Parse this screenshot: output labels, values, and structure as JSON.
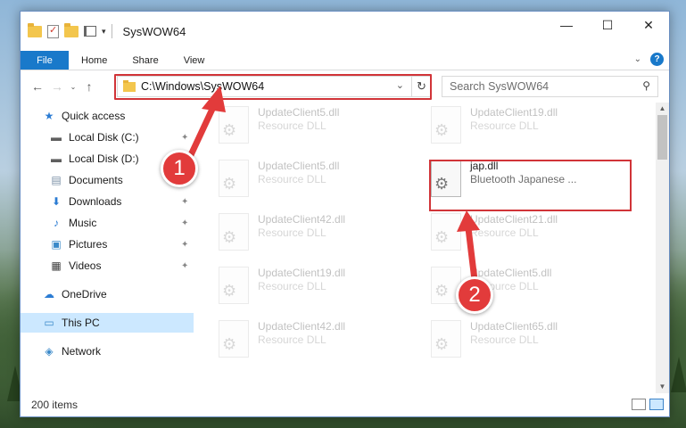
{
  "window": {
    "title": "SysWOW64",
    "minimize_glyph": "—",
    "maximize_glyph": "☐",
    "close_glyph": "✕"
  },
  "ribbon": {
    "tabs": [
      "File",
      "Home",
      "Share",
      "View"
    ],
    "expand_glyph": "⌄",
    "help_glyph": "?"
  },
  "navbar": {
    "back_glyph": "←",
    "forward_glyph": "→",
    "recent_glyph": "⌄",
    "up_glyph": "↑",
    "address": "C:\\Windows\\SysWOW64",
    "dropdown_glyph": "⌄",
    "refresh_glyph": "↻",
    "search_placeholder": "Search SysWOW64",
    "search_glyph": "⚲"
  },
  "sidebar": {
    "items": [
      {
        "label": "Quick access",
        "icon": "star-icon",
        "glyph": "★",
        "color": "#2b7cd3"
      },
      {
        "label": "Local Disk (C:)",
        "icon": "drive-icon",
        "glyph": "▬",
        "color": "#5f5f5f"
      },
      {
        "label": "Local Disk (D:)",
        "icon": "drive-icon",
        "glyph": "▬",
        "color": "#5f5f5f"
      },
      {
        "label": "Documents",
        "icon": "documents-icon",
        "glyph": "▤",
        "color": "#7a8fa6"
      },
      {
        "label": "Downloads",
        "icon": "download-icon",
        "glyph": "⬇",
        "color": "#2b7cd3"
      },
      {
        "label": "Music",
        "icon": "music-icon",
        "glyph": "♪",
        "color": "#2b7cd3"
      },
      {
        "label": "Pictures",
        "icon": "pictures-icon",
        "glyph": "▣",
        "color": "#3a89c9"
      },
      {
        "label": "Videos",
        "icon": "videos-icon",
        "glyph": "▦",
        "color": "#3b3b3b"
      },
      {
        "label": "OneDrive",
        "icon": "cloud-icon",
        "glyph": "☁",
        "color": "#2b7cd3"
      },
      {
        "label": "This PC",
        "icon": "computer-icon",
        "glyph": "▭",
        "color": "#3a89c9"
      },
      {
        "label": "Network",
        "icon": "network-icon",
        "glyph": "◈",
        "color": "#3a89c9"
      }
    ],
    "pin_glyph": "📌"
  },
  "files": [
    {
      "name": "UpdateClient5.dll",
      "type": "Resource DLL"
    },
    {
      "name": "UpdateClient19.dll",
      "type": "Resource DLL"
    },
    {
      "name": "UpdateClient5.dll",
      "type": "Resource DLL"
    },
    {
      "name": "jap.dll",
      "type": "Bluetooth Japanese ..."
    },
    {
      "name": "UpdateClient42.dll",
      "type": "Resource DLL"
    },
    {
      "name": "UpdateClient21.dll",
      "type": "Resource DLL"
    },
    {
      "name": "UpdateClient19.dll",
      "type": "Resource DLL"
    },
    {
      "name": "UpdateClient5.dll",
      "type": "Resource DLL"
    },
    {
      "name": "UpdateClient42.dll",
      "type": "Resource DLL"
    },
    {
      "name": "UpdateClient65.dll",
      "type": "Resource DLL"
    }
  ],
  "status": {
    "item_count": "200 items"
  },
  "callouts": [
    "1",
    "2"
  ],
  "colors": {
    "accent": "#1979ca",
    "highlight": "#d13438",
    "callout": "#e23b3b"
  }
}
